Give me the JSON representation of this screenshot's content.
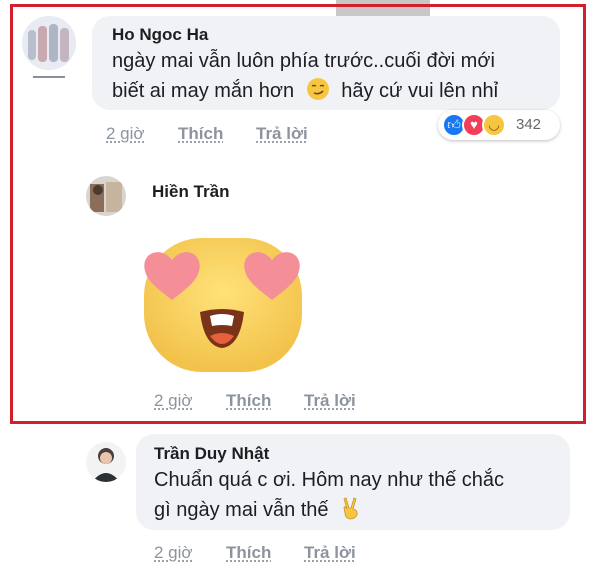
{
  "comments": [
    {
      "author": "Ho Ngoc Ha",
      "text_line1": "ngày mai vẫn luôn phía trước..cuối đời mới",
      "text_line2": "biết ai may mắn hơn",
      "text_line2b": "hãy cứ vui lên nhỉ",
      "time": "2 giờ",
      "like": "Thích",
      "reply": "Trả lời",
      "reaction_count": "342"
    },
    {
      "author": "Hiền Trần",
      "time": "2 giờ",
      "like": "Thích",
      "reply": "Trả lời"
    },
    {
      "author": "Trần Duy Nhật",
      "text_line1": "Chuẩn quá c ơi. Hôm nay như thế chắc",
      "text_line2": "gì ngày mai vẫn thế",
      "time": "2 giờ",
      "like": "Thích",
      "reply": "Trả lời"
    }
  ],
  "icons": {
    "smirk": "smirking-face-emoji",
    "peace": "victory-hand-emoji",
    "sticker": "heart-eyes-sticker",
    "reactions": [
      "like-reaction-icon",
      "love-reaction-icon",
      "haha-reaction-icon"
    ]
  },
  "colors": {
    "highlight": "#d21f2b",
    "bubble": "#f1f2f5",
    "meta": "#8d949e",
    "like": "#1877f2",
    "love": "#f33e58"
  }
}
